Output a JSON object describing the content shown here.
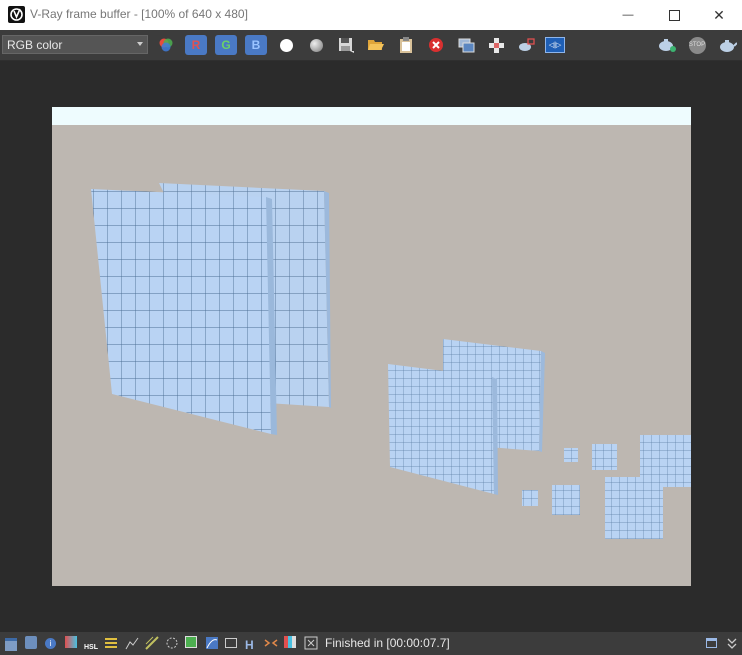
{
  "window": {
    "title": "V-Ray frame buffer - [100% of 640 x 480]",
    "minimize_glyph": "—",
    "close_glyph": "✕"
  },
  "toolbar": {
    "channel": {
      "value": "RGB color"
    },
    "r_label": "R",
    "g_label": "G",
    "b_label": "B",
    "stop_label": "STOP",
    "track_label": "◁|▷"
  },
  "status": {
    "text": "Finished in [00:00:07.7]",
    "h_label": "H",
    "hsl_label": "HSL",
    "info_label": "i"
  },
  "colors": {
    "accent": "#4a79c4",
    "background": "#bdb7b1",
    "grid_faces": "#b8d4f4"
  }
}
